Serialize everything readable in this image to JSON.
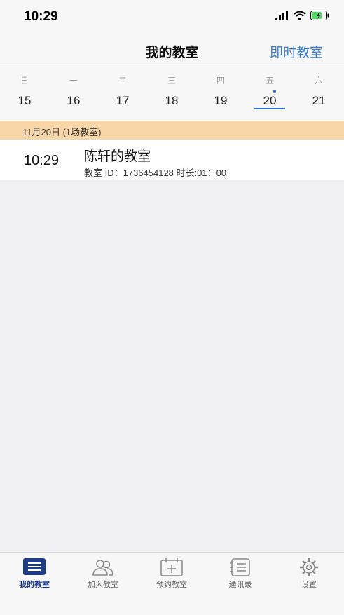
{
  "status": {
    "time": "10:29"
  },
  "nav": {
    "title": "我的教室",
    "right_action": "即时教室"
  },
  "calendar": {
    "days": [
      {
        "weekday": "日",
        "date": "15"
      },
      {
        "weekday": "一",
        "date": "16"
      },
      {
        "weekday": "二",
        "date": "17"
      },
      {
        "weekday": "三",
        "date": "18"
      },
      {
        "weekday": "四",
        "date": "19"
      },
      {
        "weekday": "五",
        "date": "20"
      },
      {
        "weekday": "六",
        "date": "21"
      }
    ],
    "selected_date": "20"
  },
  "banner": {
    "text": "11月20日 (1场教室)"
  },
  "rooms": [
    {
      "time": "10:29",
      "name": "陈轩的教室",
      "info": "教室 ID：1736454128 时长:01：00"
    }
  ],
  "tabs": [
    {
      "label": "我的教室",
      "icon": "list-icon",
      "active": true
    },
    {
      "label": "加入教室",
      "icon": "people-icon",
      "active": false
    },
    {
      "label": "预约教室",
      "icon": "calendar-plus-icon",
      "active": false
    },
    {
      "label": "通讯录",
      "icon": "contacts-icon",
      "active": false
    },
    {
      "label": "设置",
      "icon": "gear-icon",
      "active": false
    }
  ],
  "colors": {
    "accent": "#3b7fd0",
    "active_tab": "#1f3c88",
    "banner": "#f8d6a7"
  }
}
